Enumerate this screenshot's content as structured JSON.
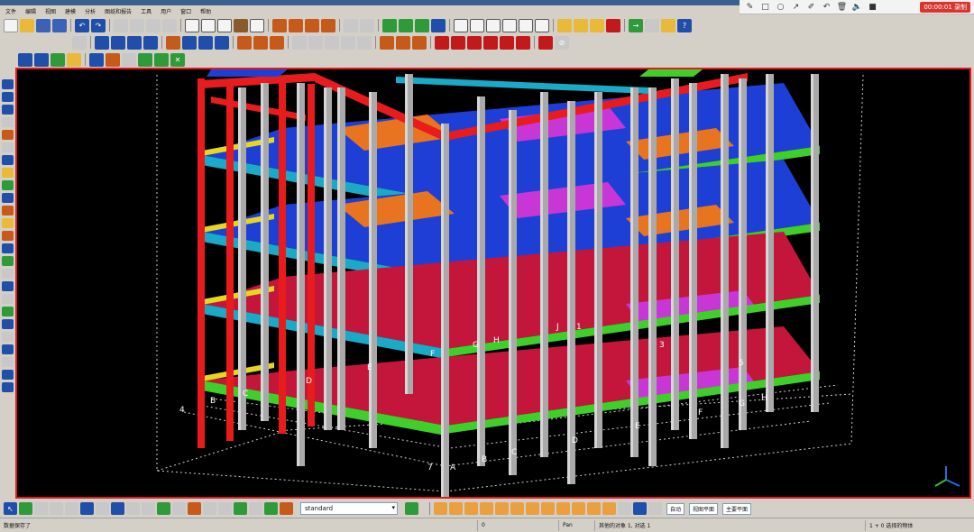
{
  "menubar": {
    "items": [
      "文件",
      "编辑",
      "视图",
      "建模",
      "分析",
      "图纸和报告",
      "工具",
      "用户",
      "窗口",
      "帮助"
    ]
  },
  "recorder": {
    "timer": "00:00:01 录制"
  },
  "bottombar": {
    "view_name": "standard",
    "combo1": "自动",
    "combo2": "视图平面",
    "combo3": "主要平面"
  },
  "statusbar": {
    "message": "数据保存了",
    "cell_left": "0",
    "cell_pan": "Pan",
    "cell_info": "其他的对象 1, 对选 1",
    "cell_right": "1 + 0 选择的物体"
  },
  "model": {
    "grid_letters_front": [
      "A",
      "B",
      "C",
      "D",
      "E",
      "F",
      "G",
      "H"
    ],
    "grid_letters_mid": [
      "E",
      "F",
      "G",
      "H",
      "J"
    ],
    "grid_numbers": [
      "1",
      "3",
      "4",
      "5",
      "7"
    ],
    "level_labels_left": [
      "B",
      "C",
      "D"
    ],
    "colors": {
      "column": "#a9a9a9",
      "beam_red": "#e81c1c",
      "beam_green": "#3fcf2a",
      "beam_cyan": "#1aa9c7",
      "slab_blue": "#1e3fd6",
      "slab_orange": "#e8741f",
      "slab_magenta": "#c837d6",
      "slab_red": "#c4163a",
      "accent_yellow": "#e6d621"
    }
  }
}
